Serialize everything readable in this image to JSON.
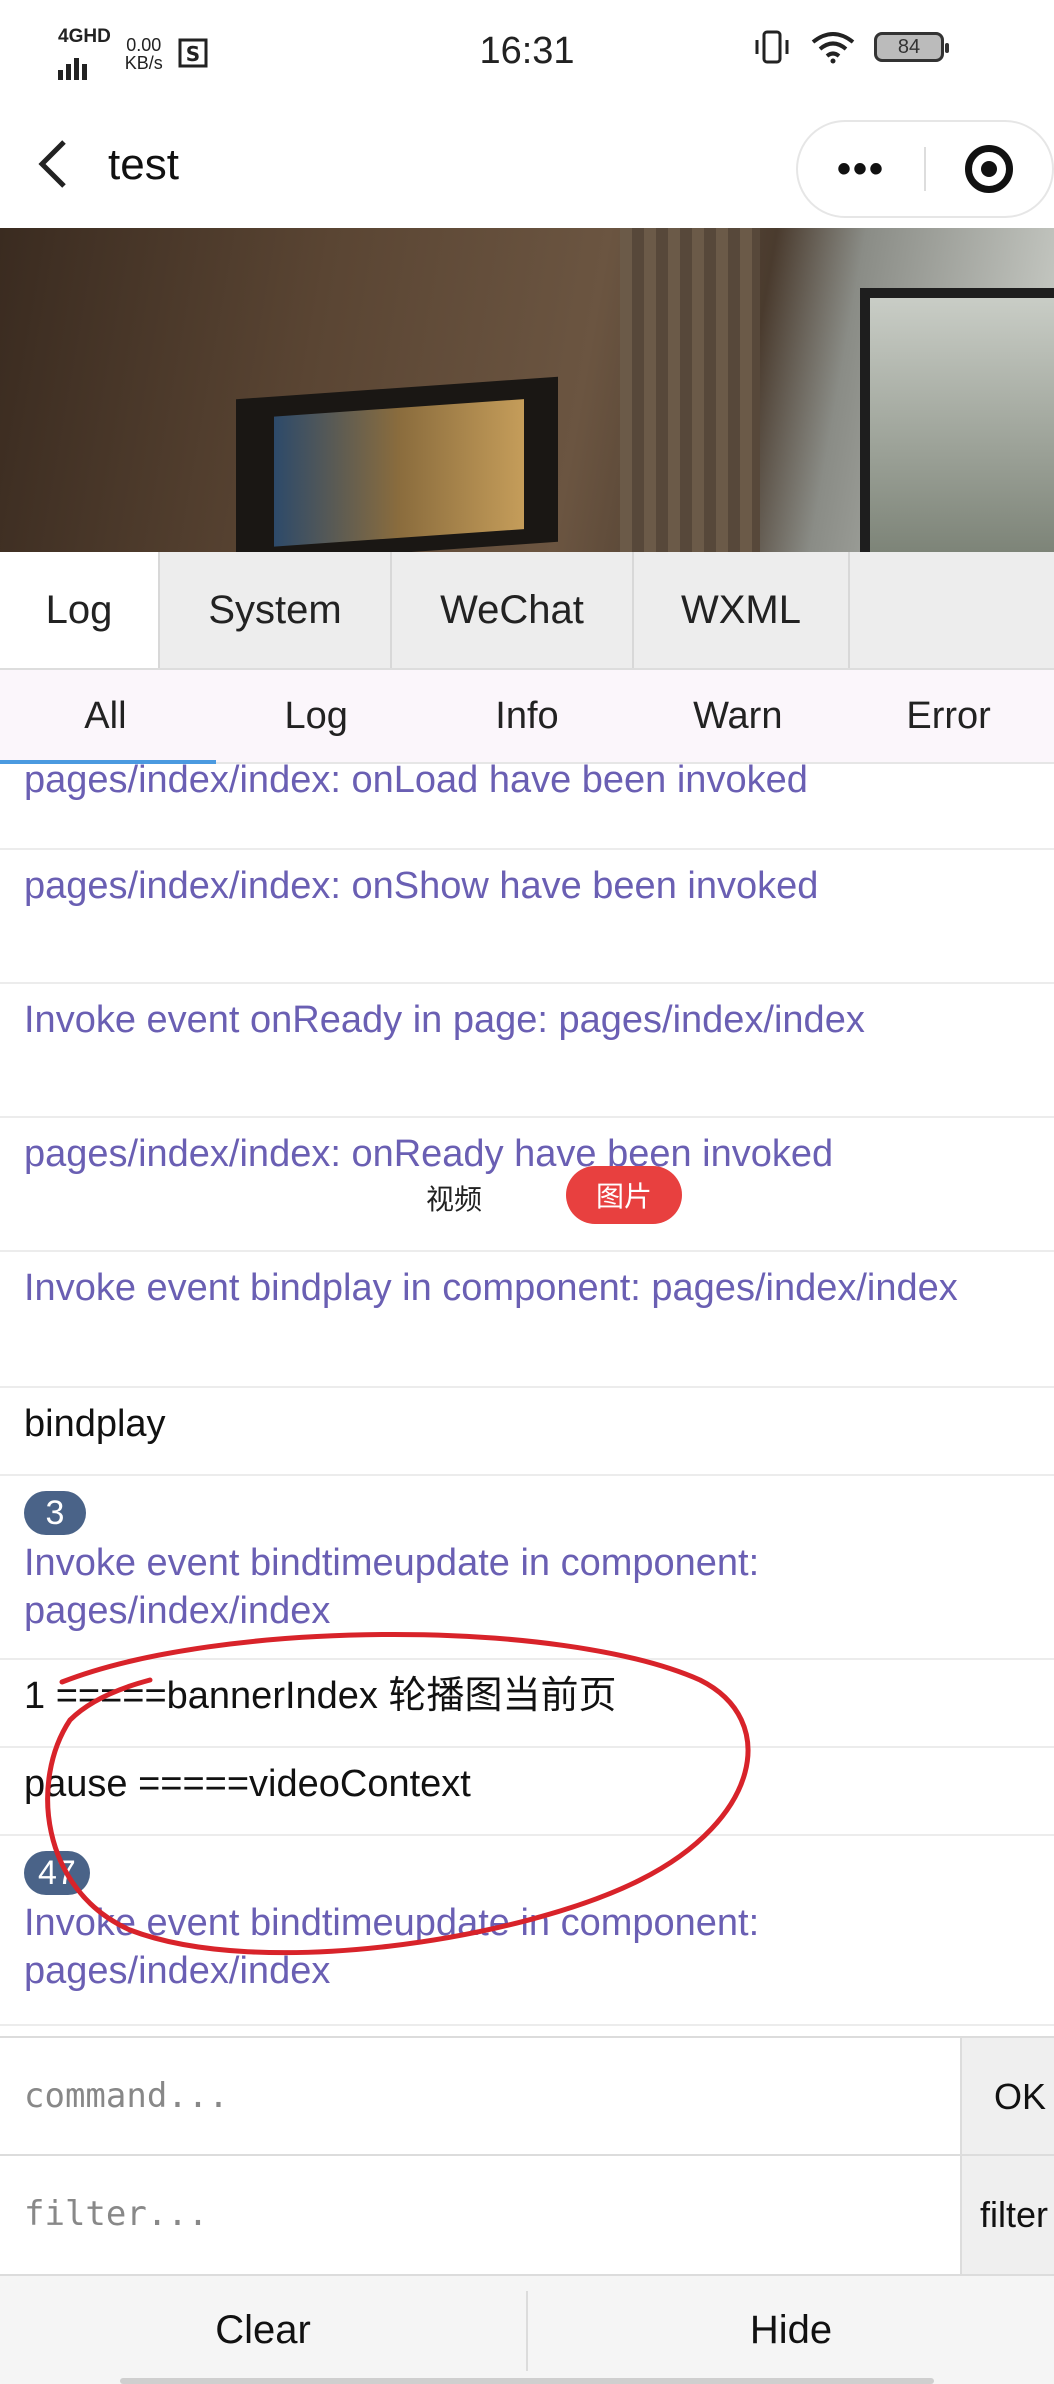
{
  "status_bar": {
    "network": "4GHD",
    "speed_value": "0.00",
    "speed_unit": "KB/s",
    "time": "16:31",
    "battery": "84",
    "icons": [
      "signal-bars-icon",
      "status-app-icon",
      "vibrate-icon",
      "wifi-icon",
      "battery-icon"
    ]
  },
  "nav": {
    "back_icon": "chevron-left-icon",
    "title": "test",
    "more_glyph": "•••"
  },
  "tabs": [
    {
      "label": "Log",
      "active": true
    },
    {
      "label": "System",
      "active": false
    },
    {
      "label": "WeChat",
      "active": false
    },
    {
      "label": "WXML",
      "active": false
    }
  ],
  "subtabs": [
    {
      "label": "All",
      "active": true
    },
    {
      "label": "Log",
      "active": false
    },
    {
      "label": "Info",
      "active": false
    },
    {
      "label": "Warn",
      "active": false
    },
    {
      "label": "Error",
      "active": false
    }
  ],
  "log": [
    {
      "text": "pages/index/index: onLoad have been invoked",
      "kind": "sys"
    },
    {
      "text": "pages/index/index: onShow have been invoked",
      "kind": "sys"
    },
    {
      "text": "Invoke event onReady in page: pages/index/index",
      "kind": "sys"
    },
    {
      "text": "pages/index/index: onReady have been invoked",
      "kind": "sys"
    },
    {
      "text": "Invoke event bindplay in component: pages/index/index",
      "kind": "sys"
    },
    {
      "text": "bindplay",
      "kind": "plain"
    },
    {
      "count": "3",
      "text": "Invoke event bindtimeupdate in component: pages/index/index",
      "kind": "sys"
    },
    {
      "text": "1 =====bannerIndex 轮播图当前页",
      "kind": "plain"
    },
    {
      "text": "pause =====videoContext",
      "kind": "plain"
    },
    {
      "count": "47",
      "text": "Invoke event bindtimeupdate in component: pages/index/index",
      "kind": "sys"
    }
  ],
  "overlay": {
    "video_label": "视频",
    "picture_label": "图片"
  },
  "command": {
    "placeholder": "command...",
    "ok_label": "OK"
  },
  "filter": {
    "placeholder": "filter...",
    "button_label": "filter"
  },
  "footer": {
    "clear_label": "Clear",
    "hide_label": "Hide"
  },
  "colors": {
    "system_log_text": "#6a5fb3",
    "repeat_badge": "#4a6388",
    "active_subtab_underline": "#4b9ae0",
    "picture_pill": "#e8403f",
    "annotation_ink": "#d8232a"
  }
}
